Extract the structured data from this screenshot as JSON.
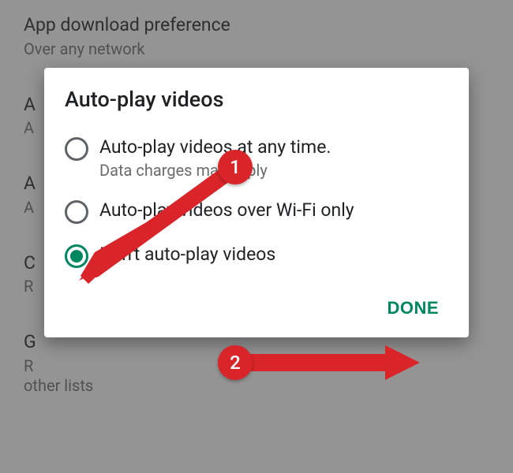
{
  "background": {
    "items": [
      {
        "title": "App download preference",
        "subtitle": "Over any network"
      },
      {
        "title": "A",
        "subtitle": "A"
      },
      {
        "title": "A",
        "subtitle": "A"
      },
      {
        "title": "C",
        "subtitle": "R"
      },
      {
        "title": "G",
        "subtitle": "R\nother lists"
      }
    ]
  },
  "dialog": {
    "title": "Auto-play videos",
    "options": [
      {
        "label": "Auto-play videos at any time.",
        "sub": "Data charges may apply",
        "selected": false
      },
      {
        "label": "Auto-play videos over Wi-Fi only",
        "sub": "",
        "selected": false
      },
      {
        "label": "Don't auto-play videos",
        "sub": "",
        "selected": true
      }
    ],
    "done": "DONE"
  },
  "annotations": {
    "callout1": "1",
    "callout2": "2"
  }
}
